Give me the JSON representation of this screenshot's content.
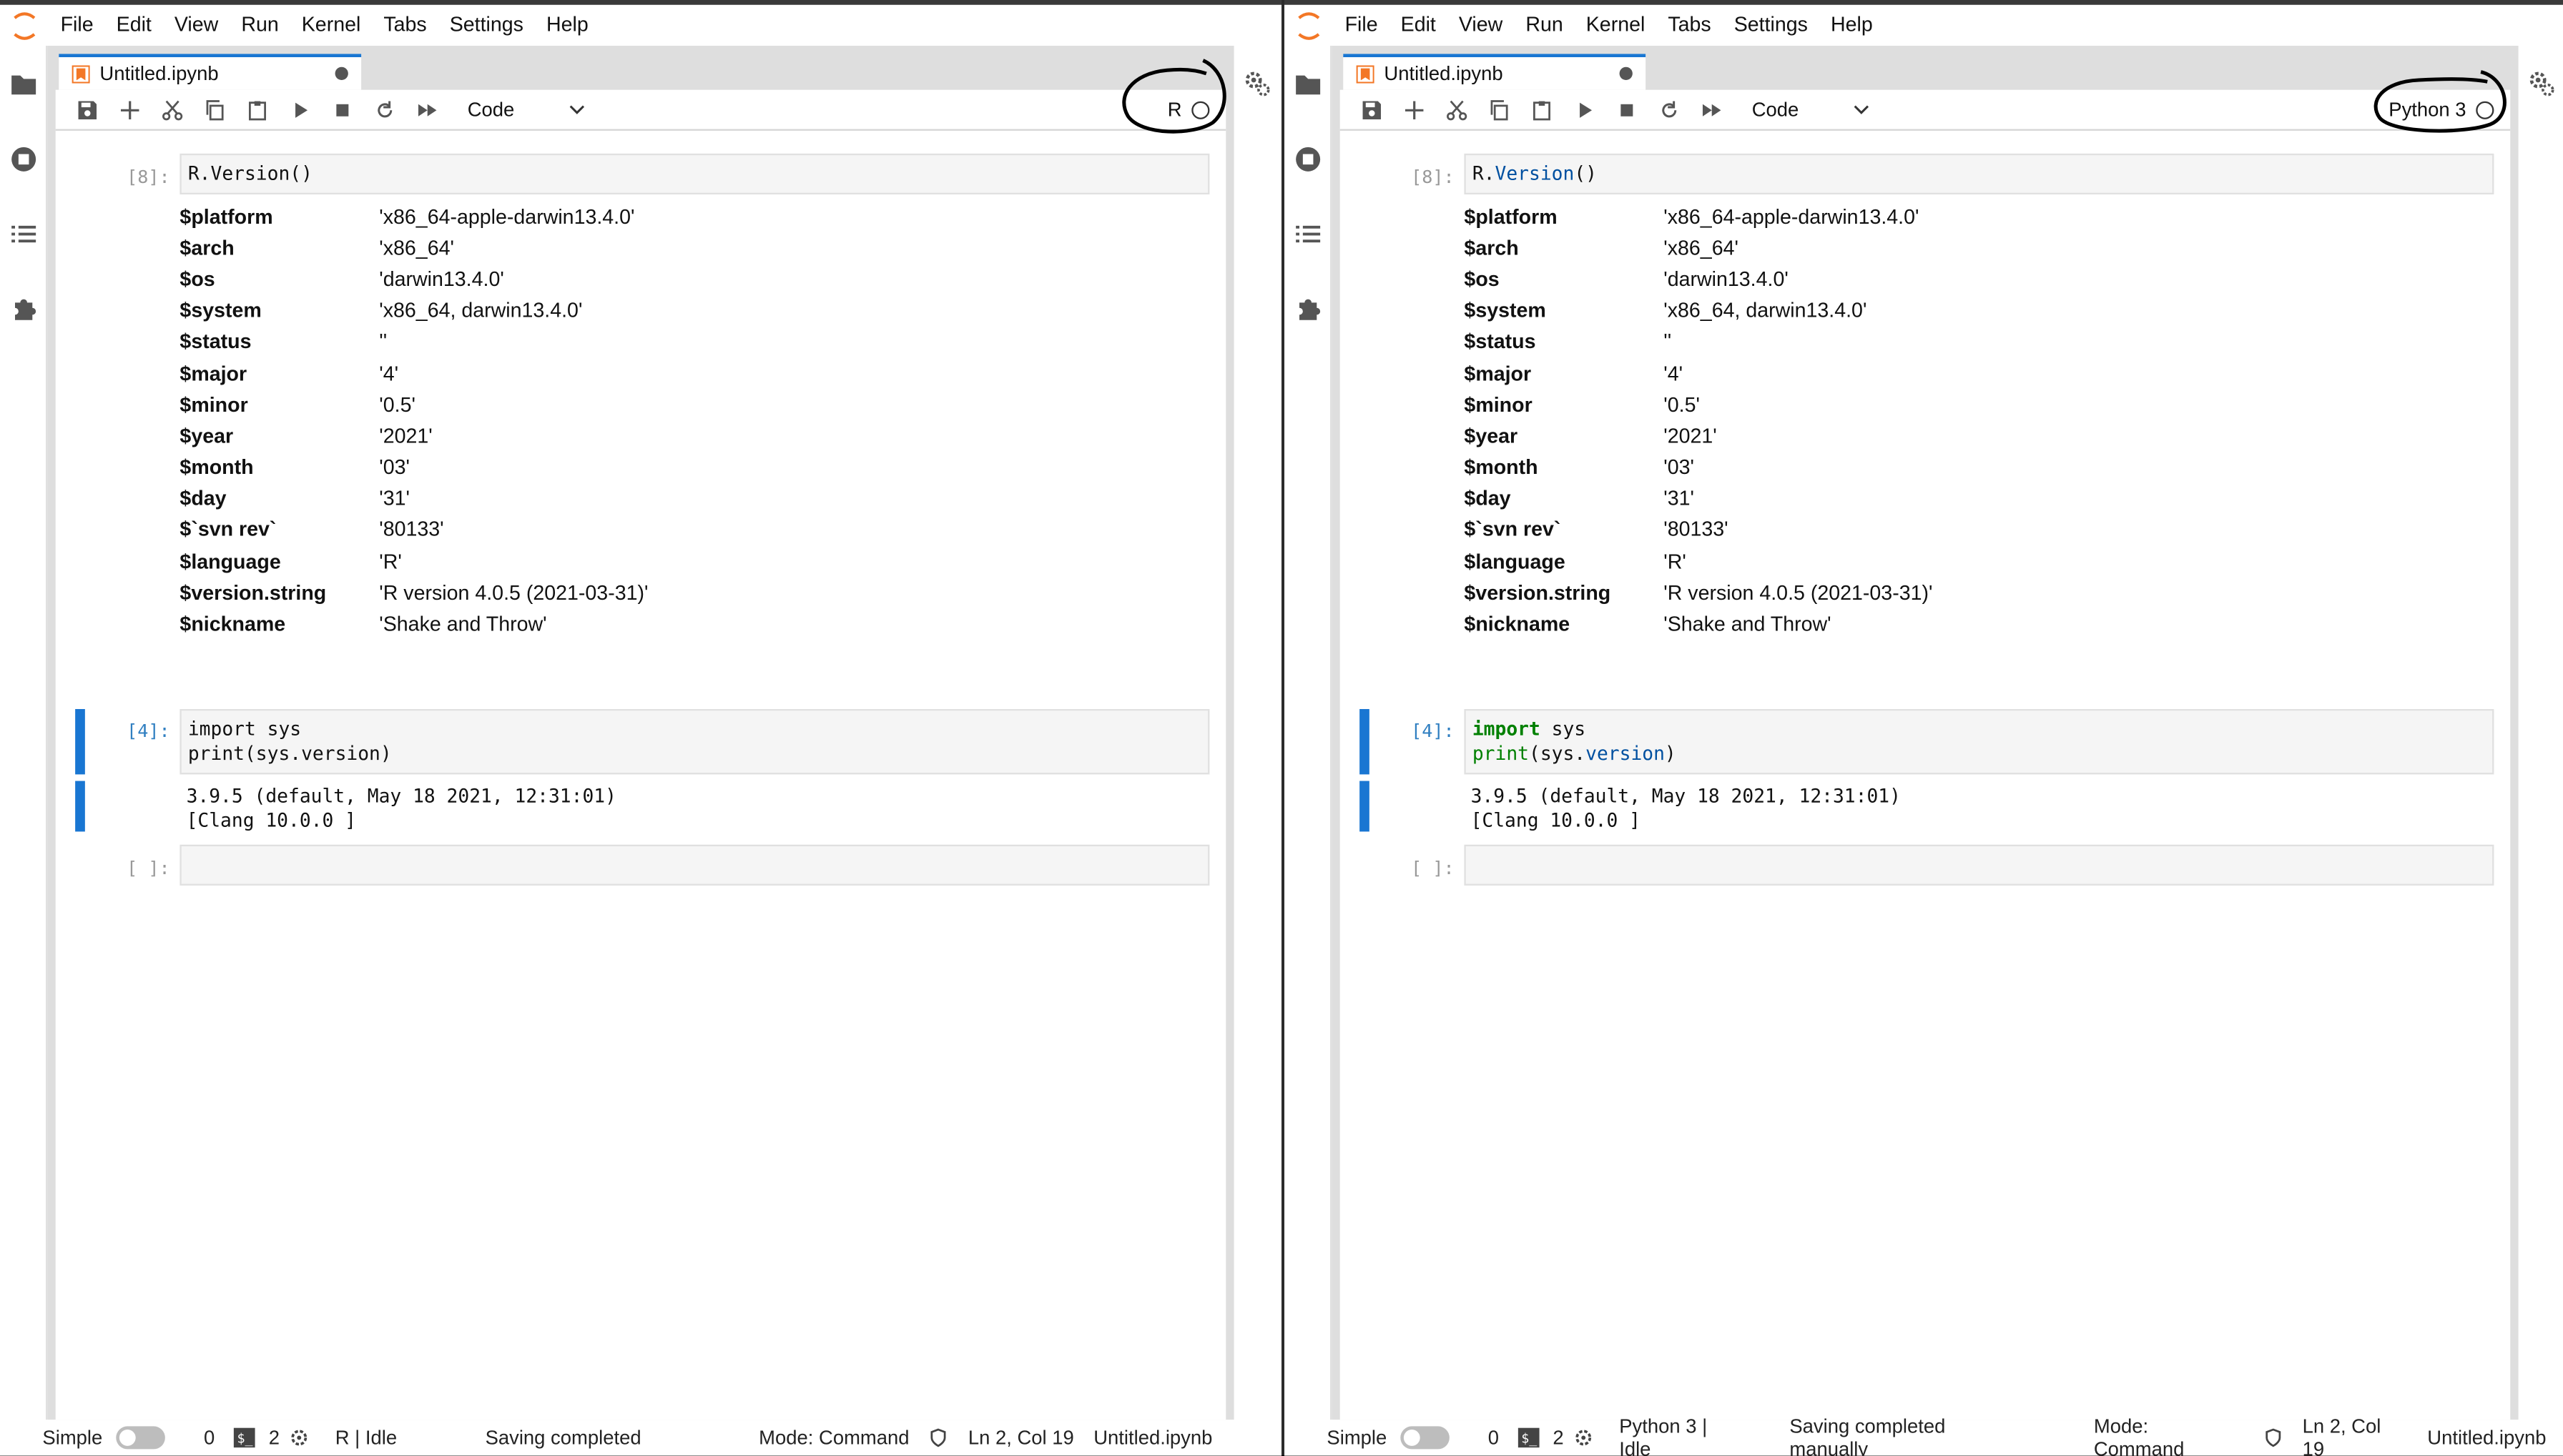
{
  "menu": [
    "File",
    "Edit",
    "View",
    "Run",
    "Kernel",
    "Tabs",
    "Settings",
    "Help"
  ],
  "colors": {
    "accent": "#1976d2",
    "prompt_active": "#307fc1",
    "keyword": "#008000"
  },
  "left": {
    "tab_title": "Untitled.ipynb",
    "cell_type": "Code",
    "kernel_name": "R",
    "cells": {
      "c1_prompt": "[8]:",
      "c1_code": "R.Version()",
      "c2_prompt": "[4]:",
      "c2_line1": "import sys",
      "c2_line2": "print(sys.version)",
      "c2_out1": "3.9.5 (default, May 18 2021, 12:31:01)",
      "c2_out2": "[Clang 10.0.0 ]",
      "c3_prompt": "[ ]:"
    },
    "status": {
      "mode_label": "Simple",
      "count_a": "0",
      "count_b": "2",
      "kernel_status": "R | Idle",
      "save_status": "Saving completed",
      "edit_mode": "Mode: Command",
      "cursor": "Ln 2, Col 19",
      "file": "Untitled.ipynb"
    }
  },
  "right": {
    "tab_title": "Untitled.ipynb",
    "cell_type": "Code",
    "kernel_name": "Python 3",
    "cells": {
      "c1_prompt": "[8]:",
      "c1_code_a": "R.",
      "c1_code_b": "Version",
      "c1_code_c": "()",
      "c2_prompt": "[4]:",
      "c2_kw": "import",
      "c2_rest": " sys",
      "c2_print": "print",
      "c2_open": "(sys.",
      "c2_attr": "version",
      "c2_close": ")",
      "c2_out1": "3.9.5 (default, May 18 2021, 12:31:01)",
      "c2_out2": "[Clang 10.0.0 ]",
      "c3_prompt": "[ ]:"
    },
    "status": {
      "mode_label": "Simple",
      "count_a": "0",
      "count_b": "2",
      "kernel_status": "Python 3 | Idle",
      "save_status": "Saving completed manually",
      "edit_mode": "Mode: Command",
      "cursor": "Ln 2, Col 19",
      "file": "Untitled.ipynb"
    }
  },
  "r_version": [
    {
      "key": "$platform",
      "value": "'x86_64-apple-darwin13.4.0'"
    },
    {
      "key": "$arch",
      "value": "'x86_64'"
    },
    {
      "key": "$os",
      "value": "'darwin13.4.0'"
    },
    {
      "key": "$system",
      "value": "'x86_64, darwin13.4.0'"
    },
    {
      "key": "$status",
      "value": "''"
    },
    {
      "key": "$major",
      "value": "'4'"
    },
    {
      "key": "$minor",
      "value": "'0.5'"
    },
    {
      "key": "$year",
      "value": "'2021'"
    },
    {
      "key": "$month",
      "value": "'03'"
    },
    {
      "key": "$day",
      "value": "'31'"
    },
    {
      "key": "$`svn rev`",
      "value": "'80133'"
    },
    {
      "key": "$language",
      "value": "'R'"
    },
    {
      "key": "$version.string",
      "value": "'R version 4.0.5 (2021-03-31)'"
    },
    {
      "key": "$nickname",
      "value": "'Shake and Throw'"
    }
  ]
}
